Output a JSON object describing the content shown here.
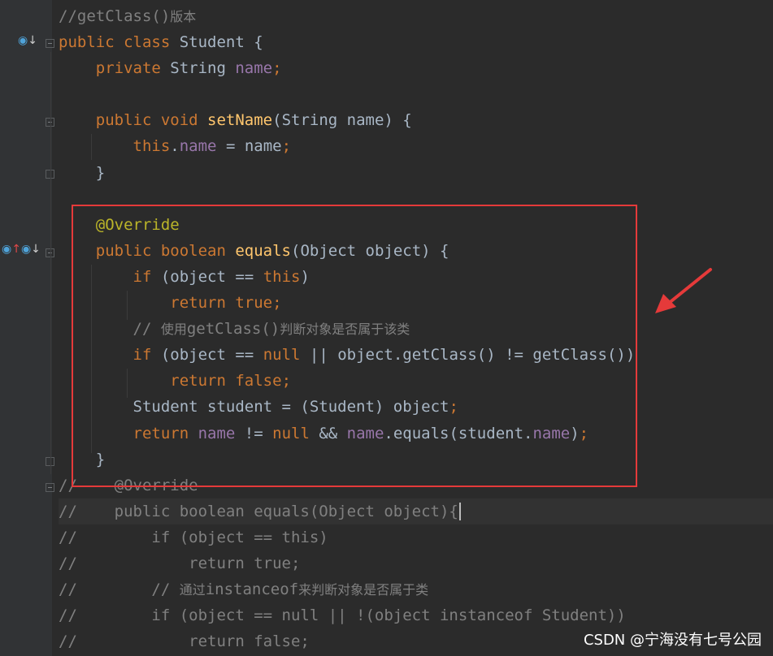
{
  "editor": {
    "lines": [
      {
        "tokens": [
          {
            "t": "//getClass()",
            "c": "cmt"
          },
          {
            "t": "版本",
            "c": "cmt cjk"
          }
        ]
      },
      {
        "tokens": [
          {
            "t": "public ",
            "c": "kw"
          },
          {
            "t": "class ",
            "c": "kw"
          },
          {
            "t": "Student {",
            "c": ""
          }
        ]
      },
      {
        "tokens": [
          {
            "t": "    ",
            "c": ""
          },
          {
            "t": "private ",
            "c": "kw"
          },
          {
            "t": "String ",
            "c": ""
          },
          {
            "t": "name",
            "c": "fld"
          },
          {
            "t": ";",
            "c": "kw"
          }
        ]
      },
      {
        "tokens": []
      },
      {
        "tokens": [
          {
            "t": "    ",
            "c": ""
          },
          {
            "t": "public ",
            "c": "kw"
          },
          {
            "t": "void ",
            "c": "kw"
          },
          {
            "t": "setName",
            "c": "fn"
          },
          {
            "t": "(String name) {",
            "c": ""
          }
        ]
      },
      {
        "tokens": [
          {
            "t": "        ",
            "c": ""
          },
          {
            "t": "this",
            "c": "kw"
          },
          {
            "t": ".",
            "c": ""
          },
          {
            "t": "name",
            "c": "fld"
          },
          {
            "t": " = name",
            "c": ""
          },
          {
            "t": ";",
            "c": "kw"
          }
        ]
      },
      {
        "tokens": [
          {
            "t": "    }",
            "c": ""
          }
        ]
      },
      {
        "tokens": []
      },
      {
        "tokens": [
          {
            "t": "    ",
            "c": ""
          },
          {
            "t": "@Override",
            "c": "ann"
          }
        ]
      },
      {
        "tokens": [
          {
            "t": "    ",
            "c": ""
          },
          {
            "t": "public ",
            "c": "kw"
          },
          {
            "t": "boolean ",
            "c": "kw"
          },
          {
            "t": "equals",
            "c": "fn"
          },
          {
            "t": "(Object object) {",
            "c": ""
          }
        ]
      },
      {
        "tokens": [
          {
            "t": "        ",
            "c": ""
          },
          {
            "t": "if ",
            "c": "kw"
          },
          {
            "t": "(object == ",
            "c": ""
          },
          {
            "t": "this",
            "c": "kw"
          },
          {
            "t": ")",
            "c": ""
          }
        ]
      },
      {
        "tokens": [
          {
            "t": "            ",
            "c": ""
          },
          {
            "t": "return ",
            "c": "kw"
          },
          {
            "t": "true",
            "c": "kw"
          },
          {
            "t": ";",
            "c": "kw"
          }
        ]
      },
      {
        "tokens": [
          {
            "t": "        ",
            "c": ""
          },
          {
            "t": "// ",
            "c": "cmt"
          },
          {
            "t": "使用",
            "c": "cmt cjk"
          },
          {
            "t": "getClass()",
            "c": "cmt"
          },
          {
            "t": "判断对象是否属于该类",
            "c": "cmt cjk"
          }
        ]
      },
      {
        "tokens": [
          {
            "t": "        ",
            "c": ""
          },
          {
            "t": "if ",
            "c": "kw"
          },
          {
            "t": "(object == ",
            "c": ""
          },
          {
            "t": "null ",
            "c": "kw"
          },
          {
            "t": "|| object.getClass() != getClass())",
            "c": ""
          }
        ]
      },
      {
        "tokens": [
          {
            "t": "            ",
            "c": ""
          },
          {
            "t": "return ",
            "c": "kw"
          },
          {
            "t": "false",
            "c": "kw"
          },
          {
            "t": ";",
            "c": "kw"
          }
        ]
      },
      {
        "tokens": [
          {
            "t": "        ",
            "c": ""
          },
          {
            "t": "Student student = (Student) object",
            "c": ""
          },
          {
            "t": ";",
            "c": "kw"
          }
        ]
      },
      {
        "tokens": [
          {
            "t": "        ",
            "c": ""
          },
          {
            "t": "return ",
            "c": "kw"
          },
          {
            "t": "name",
            "c": "fld"
          },
          {
            "t": " != ",
            "c": ""
          },
          {
            "t": "null ",
            "c": "kw"
          },
          {
            "t": "&& ",
            "c": ""
          },
          {
            "t": "name",
            "c": "fld"
          },
          {
            "t": ".equals(student.",
            "c": ""
          },
          {
            "t": "name",
            "c": "fld"
          },
          {
            "t": ")",
            "c": ""
          },
          {
            "t": ";",
            "c": "kw"
          }
        ]
      },
      {
        "tokens": [
          {
            "t": "    }",
            "c": ""
          }
        ]
      },
      {
        "tokens": [
          {
            "t": "//    @Override",
            "c": "cmt"
          }
        ]
      },
      {
        "tokens": [
          {
            "t": "//    public boolean equals(Object object){",
            "c": "cmt"
          }
        ],
        "current": true
      },
      {
        "tokens": [
          {
            "t": "//        if (object == this)",
            "c": "cmt"
          }
        ]
      },
      {
        "tokens": [
          {
            "t": "//            return true;",
            "c": "cmt"
          }
        ]
      },
      {
        "tokens": [
          {
            "t": "//        // ",
            "c": "cmt"
          },
          {
            "t": "通过",
            "c": "cmt cjk"
          },
          {
            "t": "instanceof",
            "c": "cmt"
          },
          {
            "t": "来判断对象是否属于类",
            "c": "cmt cjk"
          }
        ]
      },
      {
        "tokens": [
          {
            "t": "//        if (object == null || !(object instanceof Student))",
            "c": "cmt"
          }
        ]
      },
      {
        "tokens": [
          {
            "t": "//            return false;",
            "c": "cmt"
          }
        ]
      }
    ]
  },
  "gutter_icons": {
    "class_icon": "◉↓",
    "method_icon": "◉↑◉↓"
  },
  "watermark": "CSDN @宁海没有七号公园",
  "colors": {
    "background": "#2b2b2b",
    "keyword": "#cc7832",
    "field": "#9876aa",
    "method": "#ffc66d",
    "annotation": "#bbb529",
    "comment": "#808080",
    "highlight_box": "#e53a3a"
  }
}
